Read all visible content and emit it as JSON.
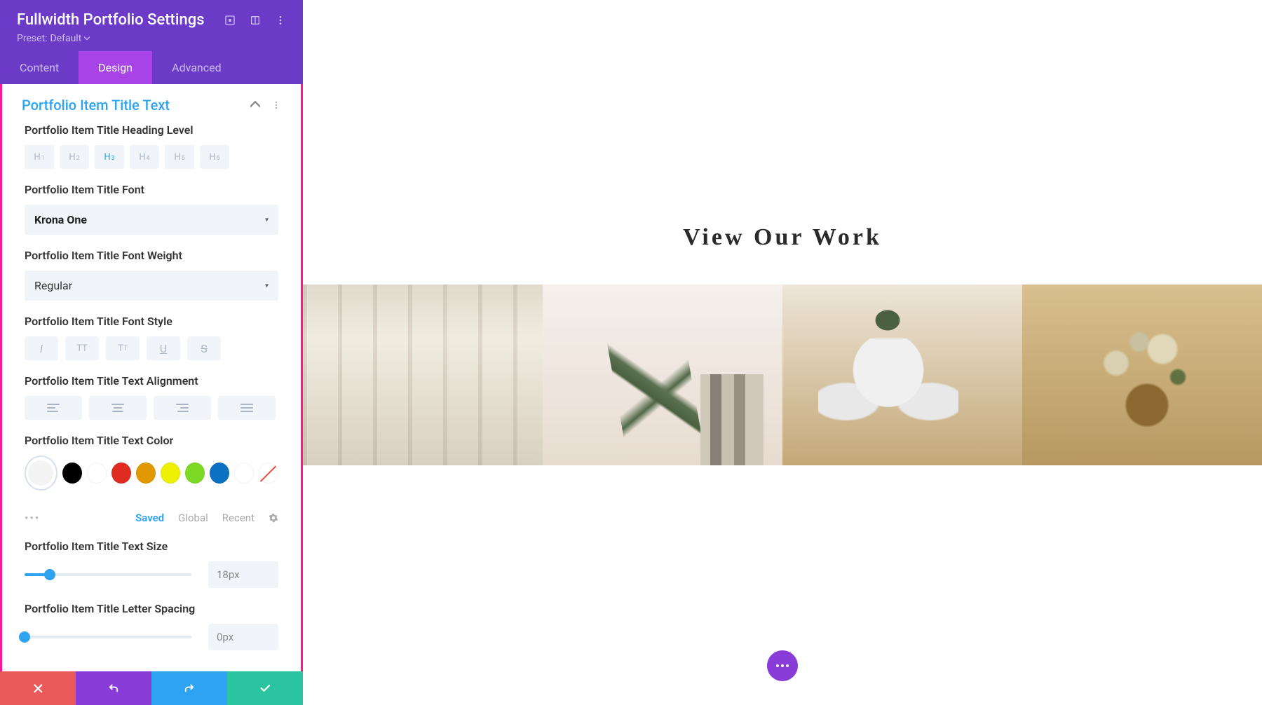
{
  "header": {
    "title": "Fullwidth Portfolio Settings",
    "preset_label": "Preset:",
    "preset_value": "Default"
  },
  "tabs": {
    "content": "Content",
    "design": "Design",
    "advanced": "Advanced"
  },
  "section": {
    "title": "Portfolio Item Title Text"
  },
  "fields": {
    "heading_level": {
      "label": "Portfolio Item Title Heading Level",
      "options": [
        "H1",
        "H2",
        "H3",
        "H4",
        "H5",
        "H6"
      ],
      "active": "H3"
    },
    "font": {
      "label": "Portfolio Item Title Font",
      "value": "Krona One"
    },
    "weight": {
      "label": "Portfolio Item Title Font Weight",
      "value": "Regular"
    },
    "style": {
      "label": "Portfolio Item Title Font Style"
    },
    "align": {
      "label": "Portfolio Item Title Text Alignment"
    },
    "color": {
      "label": "Portfolio Item Title Text Color",
      "swatches": [
        "#000000",
        "#ffffff",
        "#e02b20",
        "#e09900",
        "#edf000",
        "#7cda24",
        "#0c71c3",
        "#ffffff"
      ],
      "tabs": {
        "saved": "Saved",
        "global": "Global",
        "recent": "Recent"
      }
    },
    "size": {
      "label": "Portfolio Item Title Text Size",
      "value": "18px",
      "percent": 15
    },
    "spacing": {
      "label": "Portfolio Item Title Letter Spacing",
      "value": "0px",
      "percent": 0
    }
  },
  "preview": {
    "title": "View Our Work"
  }
}
